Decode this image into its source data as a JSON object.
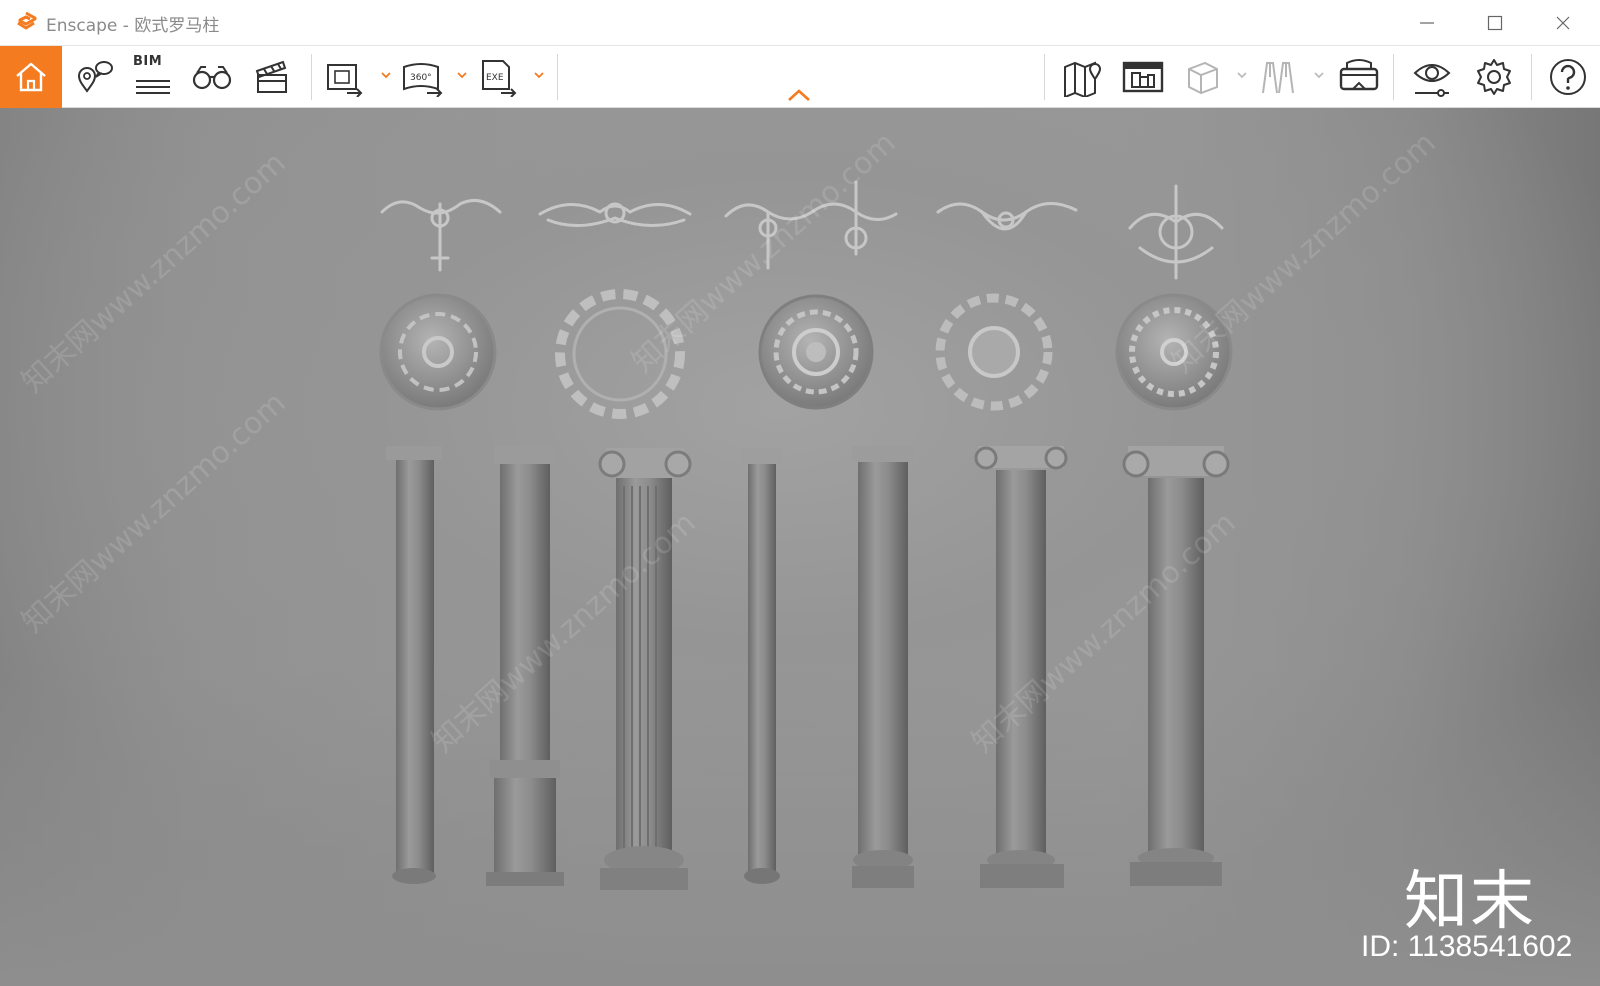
{
  "window": {
    "app_name": "Enscape",
    "separator": "-",
    "document_title": "欧式罗马柱",
    "controls": [
      "minimize",
      "maximize",
      "close"
    ]
  },
  "toolbar": {
    "accent_color": "#f47b20",
    "left_group": [
      {
        "name": "home",
        "icon": "home-icon"
      },
      {
        "name": "views",
        "icon": "map-pin-speech-icon"
      },
      {
        "name": "bim",
        "label": "BIM",
        "icon": "bim-lines-icon"
      },
      {
        "name": "visual-settings",
        "icon": "binoculars-icon"
      },
      {
        "name": "video-editor",
        "icon": "clapperboard-icon"
      }
    ],
    "export_group": [
      {
        "name": "render-export",
        "icon": "image-export-icon"
      },
      {
        "name": "panorama-export",
        "label": "360°",
        "icon": "panorama-export-icon"
      },
      {
        "name": "exe-export",
        "label": "EXE",
        "icon": "exe-export-icon"
      }
    ],
    "right_group": [
      {
        "name": "map",
        "icon": "map-icon"
      },
      {
        "name": "asset-library",
        "icon": "asset-library-icon"
      },
      {
        "name": "cube",
        "icon": "cube-icon"
      },
      {
        "name": "walkthrough",
        "icon": "walk-icon"
      },
      {
        "name": "vr-headset",
        "icon": "vr-headset-icon"
      },
      {
        "name": "view-toggle",
        "icon": "eye-icon"
      },
      {
        "name": "settings",
        "icon": "gear-icon"
      },
      {
        "name": "help",
        "icon": "help-icon"
      }
    ]
  },
  "viewport": {
    "watermark_text": "知末网www.znzmo.com",
    "brand": "知末",
    "id_label": "ID: 1138541602",
    "ornament_count": 5,
    "medallion_count": 5,
    "column_count": 7
  }
}
